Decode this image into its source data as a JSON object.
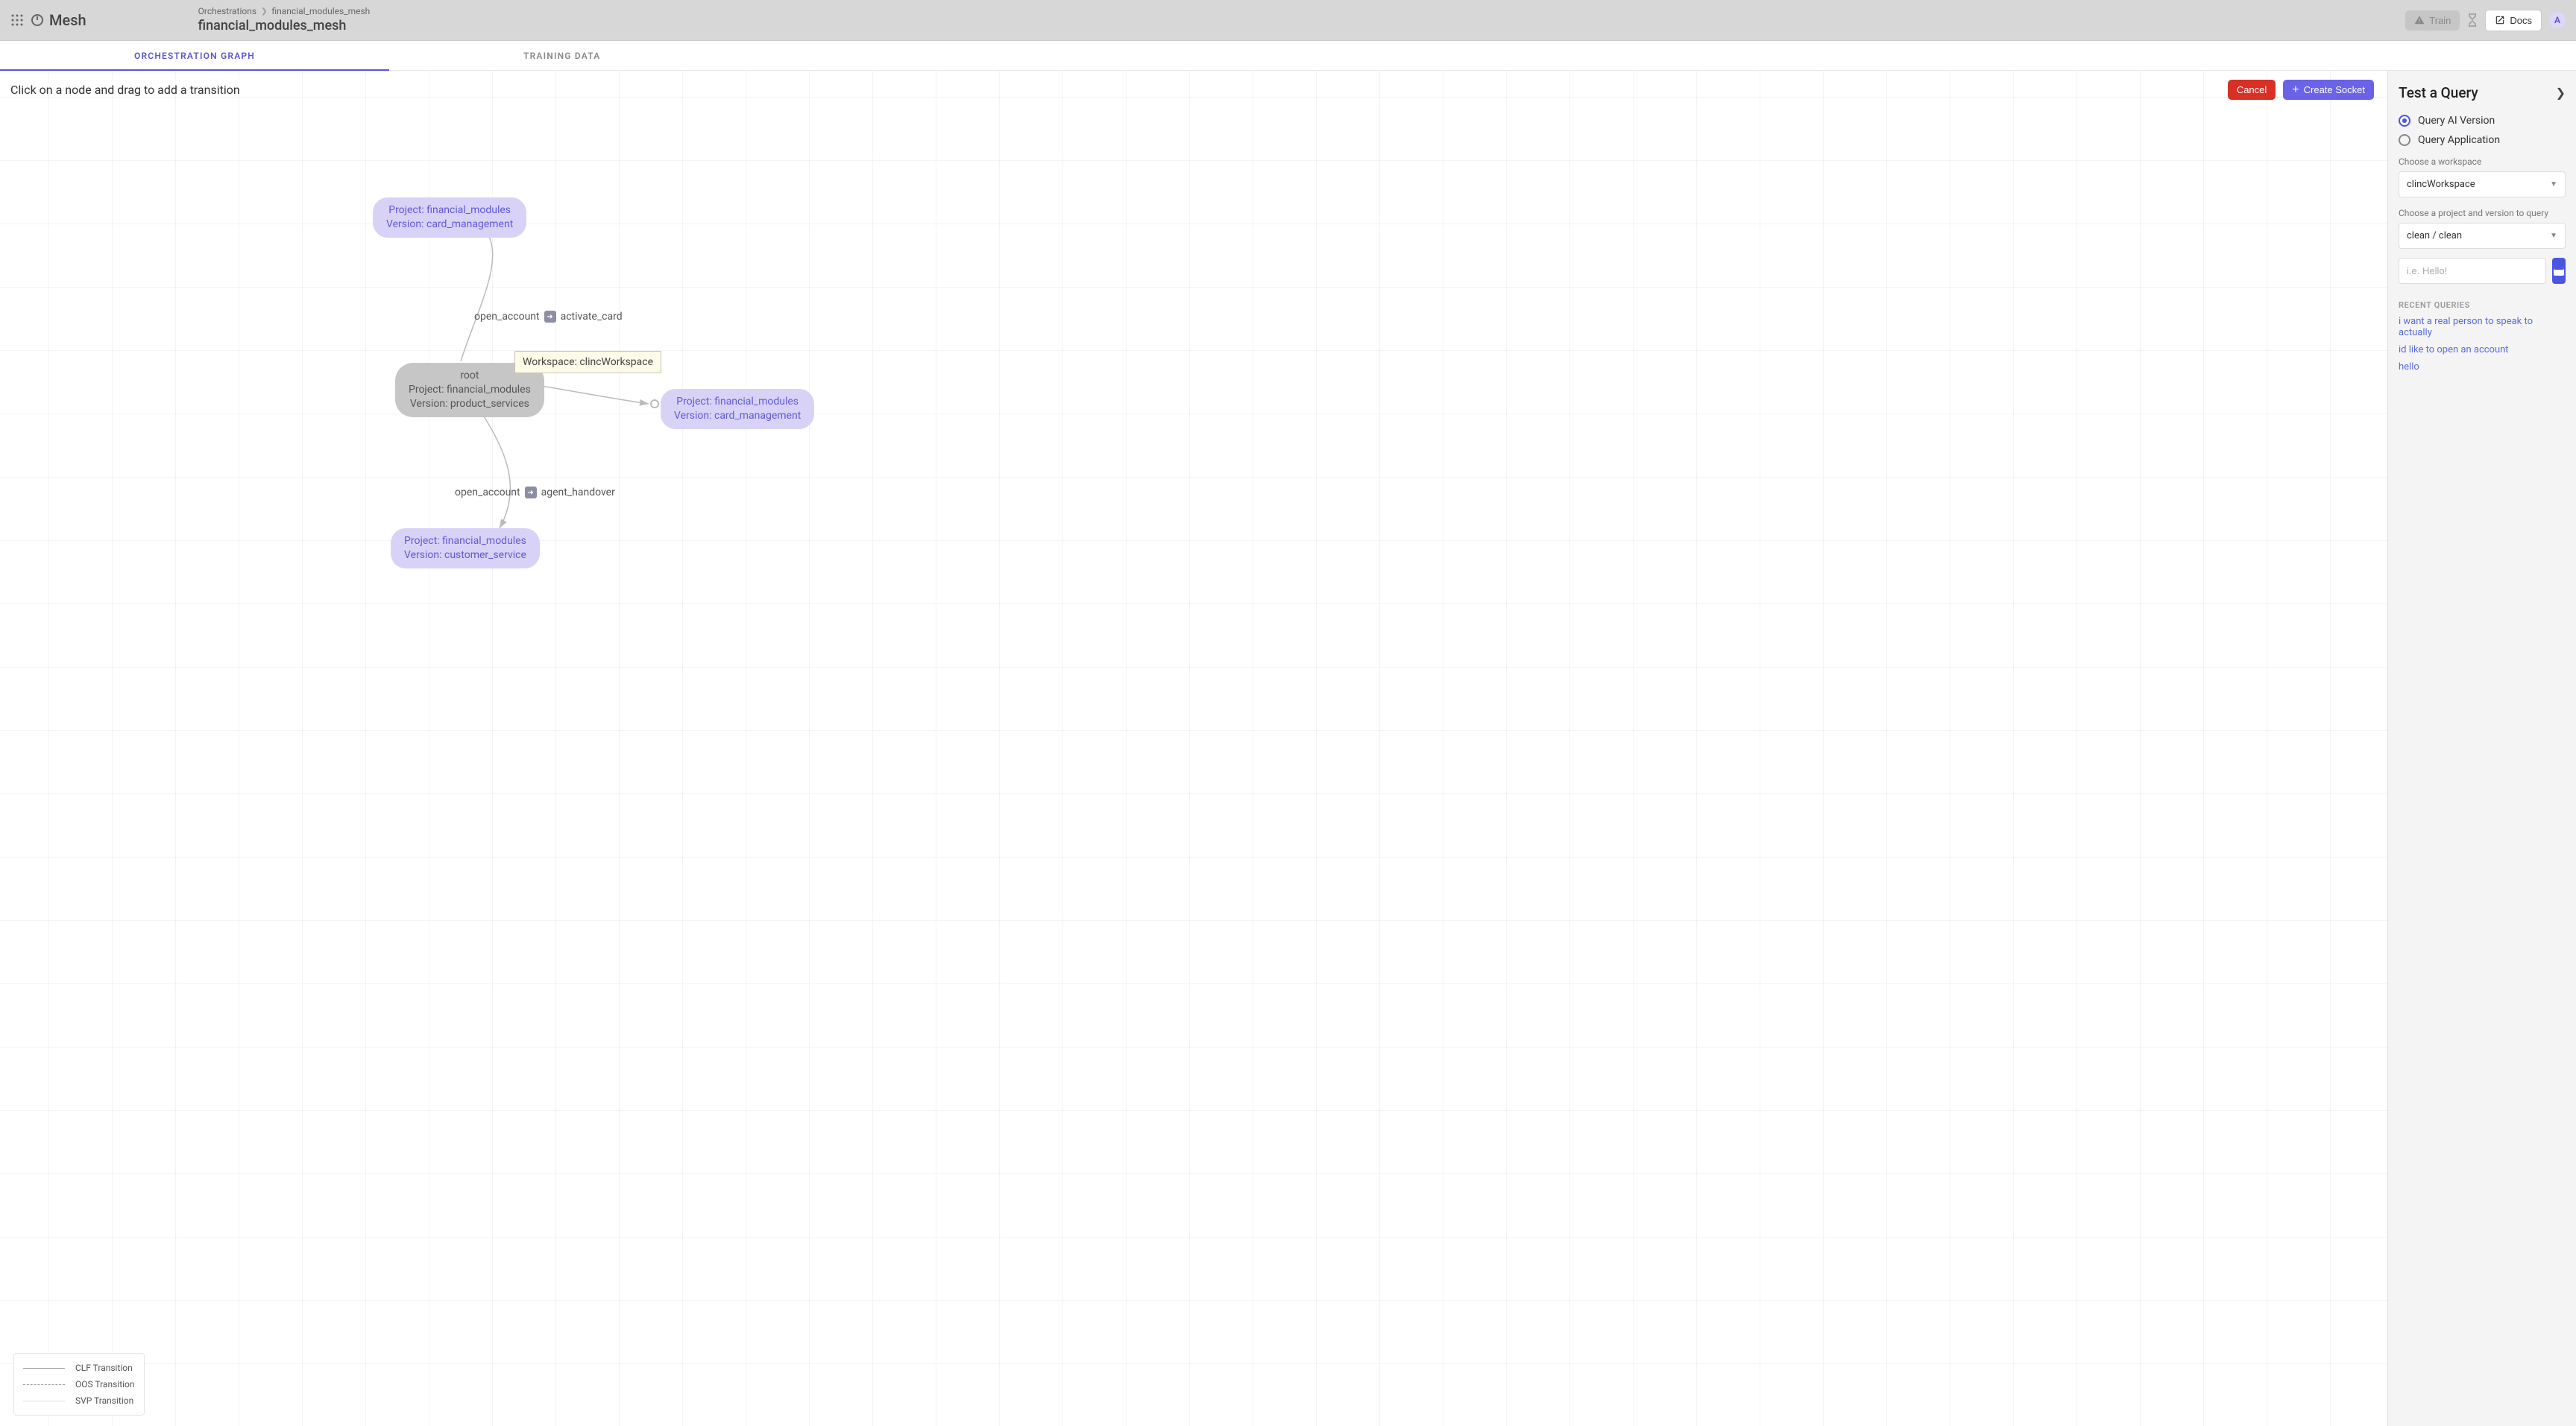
{
  "brand": "Mesh",
  "breadcrumb": {
    "root": "Orchestrations",
    "leaf": "financial_modules_mesh"
  },
  "page_title": "financial_modules_mesh",
  "topbar": {
    "train": "Train",
    "docs": "Docs",
    "avatar_initial": "A"
  },
  "tabs": {
    "graph": "ORCHESTRATION GRAPH",
    "training": "TRAINING DATA"
  },
  "canvas": {
    "hint": "Click on a node and drag to add a transition",
    "cancel": "Cancel",
    "create_socket": "Create Socket"
  },
  "nodes": {
    "root": {
      "line1": "root",
      "line2": "Project: financial_modules",
      "line3": "Version: product_services"
    },
    "top": {
      "line1": "Project: financial_modules",
      "line2": "Version: card_management"
    },
    "right": {
      "line1": "Project: financial_modules",
      "line2": "Version: card_management"
    },
    "bottom": {
      "line1": "Project: financial_modules",
      "line2": "Version: customer_service"
    }
  },
  "tooltip": "Workspace: clincWorkspace",
  "edge_labels": {
    "top": {
      "from": "open_account",
      "to": "activate_card"
    },
    "bottom": {
      "from": "open_account",
      "to": "agent_handover"
    }
  },
  "legend": {
    "clf": "CLF Transition",
    "oos": "OOS Transition",
    "svp": "SVP Transition"
  },
  "panel": {
    "title": "Test a Query",
    "radio_ai": "Query AI Version",
    "radio_app": "Query Application",
    "workspace_label": "Choose a workspace",
    "workspace_value": "clincWorkspace",
    "project_label": "Choose a project and version to query",
    "project_value": "clean / clean",
    "query_placeholder": "i.e. Hello!",
    "recent_header": "RECENT QUERIES",
    "recent": [
      "i want a real person to speak to actually",
      "id like to open an account",
      "hello"
    ]
  }
}
